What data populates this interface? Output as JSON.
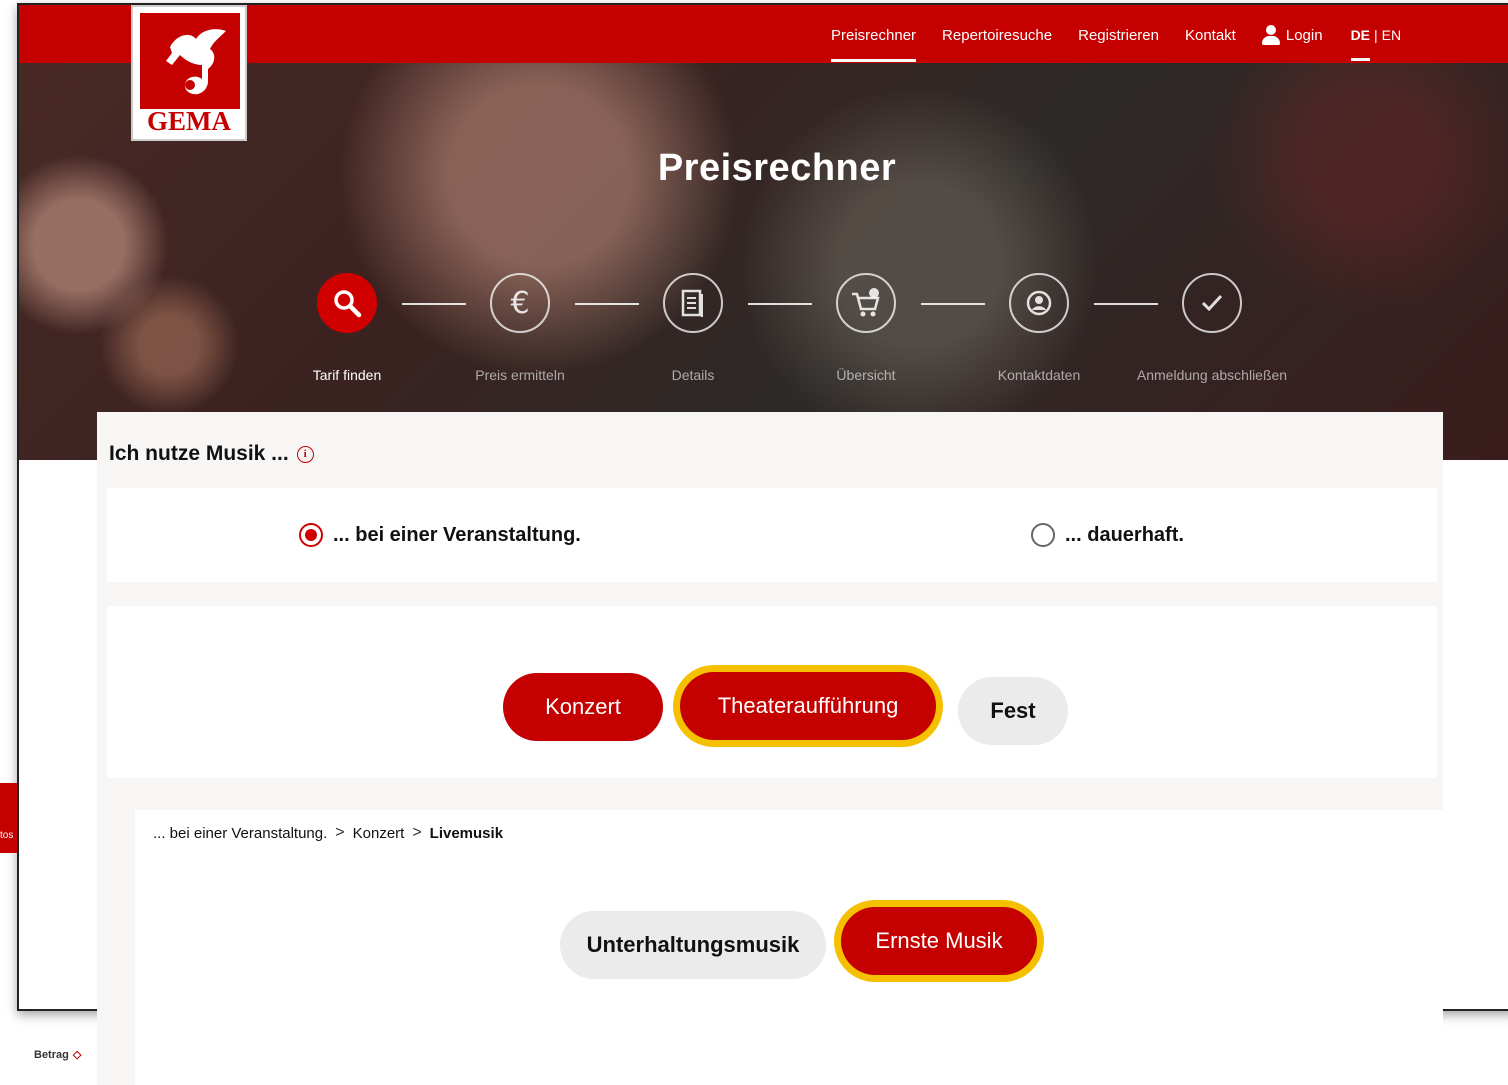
{
  "nav": {
    "items": [
      "Preisrechner",
      "Repertoiresuche",
      "Registrieren",
      "Kontakt"
    ],
    "login": "Login",
    "lang_de": "DE",
    "lang_sep": "|",
    "lang_en": "EN"
  },
  "logo": {
    "text": "GEMA"
  },
  "hero": {
    "title": "Preisrechner"
  },
  "steps": [
    {
      "label": "Tarif finden",
      "icon": "search-icon"
    },
    {
      "label": "Preis ermitteln",
      "icon": "euro-icon"
    },
    {
      "label": "Details",
      "icon": "document-icon"
    },
    {
      "label": "Übersicht",
      "icon": "cart-icon"
    },
    {
      "label": "Kontaktdaten",
      "icon": "person-icon"
    },
    {
      "label": "Anmeldung abschließen",
      "icon": "checkmark-icon"
    }
  ],
  "side": {
    "truncated": "tos",
    "sort_label": "Betrag"
  },
  "question": {
    "title": "Ich nutze Musik ...",
    "info": "i"
  },
  "usage_options": [
    {
      "label": "... bei einer Veranstaltung.",
      "checked": true
    },
    {
      "label": "... dauerhaft.",
      "checked": false
    }
  ],
  "event_types": [
    {
      "label": "Konzert"
    },
    {
      "label": "Theateraufführung"
    },
    {
      "label": "Fest"
    }
  ],
  "breadcrumb": [
    "... bei einer Veranstaltung.",
    "Konzert",
    "Livemusik"
  ],
  "music_types": [
    {
      "label": "Unterhaltungsmusik"
    },
    {
      "label": "Ernste Musik"
    }
  ],
  "colors": {
    "brand": "#c40000",
    "focus": "#f5c000"
  }
}
